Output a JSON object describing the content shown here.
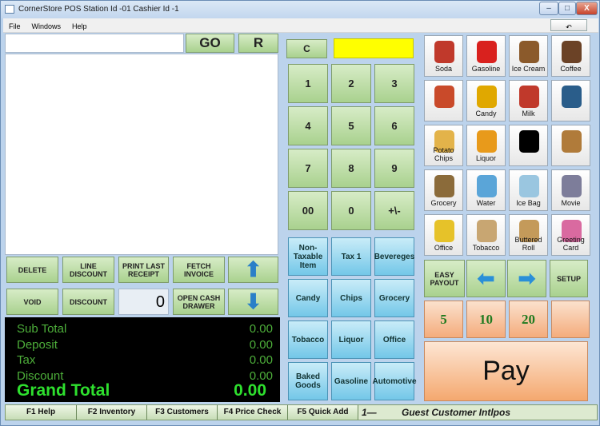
{
  "window": {
    "title": "CornerStore POS Station Id -01 Cashier Id -1",
    "min": "–",
    "max": "□",
    "close": "X"
  },
  "menu": [
    "File",
    "Windows",
    "Help"
  ],
  "undo_icon": "undo-arrow-icon",
  "entry": {
    "go": "GO",
    "r": "R",
    "value": ""
  },
  "keypad": {
    "clear": "C",
    "keys": [
      "1",
      "2",
      "3",
      "4",
      "5",
      "6",
      "7",
      "8",
      "9",
      "00",
      "0",
      "+\\-"
    ]
  },
  "actions": {
    "delete": "DELETE",
    "line_discount": "LINE DISCOUNT",
    "print_last": "PRINT LAST RECEIPT",
    "fetch": "FETCH INVOICE",
    "void": "VOID",
    "discount": "DISCOUNT",
    "qty": "0",
    "open_drawer": "OPEN CASH DRAWER"
  },
  "totals": {
    "subtotal_label": "Sub Total",
    "subtotal": "0.00",
    "deposit_label": "Deposit",
    "deposit": "0.00",
    "tax_label": "Tax",
    "tax": "0.00",
    "discount_label": "Discount",
    "discount": "0.00",
    "grand_label": "Grand Total",
    "grand": "0.00"
  },
  "categories": [
    "Non-Taxable Item",
    "Tax 1",
    "Bevereges",
    "Candy",
    "Chips",
    "Grocery",
    "Tobacco",
    "Liquor",
    "Office",
    "Baked Goods",
    "Gasoline",
    "Automotive"
  ],
  "products": [
    {
      "label": "Soda",
      "icon": "soda-icon",
      "color": "#c0392b"
    },
    {
      "label": "Gasoline",
      "icon": "gas-can-icon",
      "color": "#d9211e"
    },
    {
      "label": "Ice Cream",
      "icon": "ice-cream-icon",
      "color": "#8b5a2b"
    },
    {
      "label": "Coffee",
      "icon": "coffee-cup-icon",
      "color": "#6b4226"
    },
    {
      "label": "",
      "icon": "popcorn-icon",
      "color": "#c94a2a"
    },
    {
      "label": "Candy",
      "icon": "candy-icon",
      "color": "#e0a800"
    },
    {
      "label": "Milk",
      "icon": "milk-icon",
      "color": "#c0392b"
    },
    {
      "label": "",
      "icon": "magazine-icon",
      "color": "#2a5d8a"
    },
    {
      "label": "Potato Chips",
      "icon": "chips-icon",
      "color": "#e3b34a"
    },
    {
      "label": "Liquor",
      "icon": "liquor-glass-icon",
      "color": "#e89a1b"
    },
    {
      "label": "",
      "icon": "car-service-icon",
      "color": "#000000"
    },
    {
      "label": "",
      "icon": "cookies-icon",
      "color": "#b07b3a"
    },
    {
      "label": "Grocery",
      "icon": "grocery-bag-icon",
      "color": "#8b6b3a"
    },
    {
      "label": "Water",
      "icon": "water-bottle-icon",
      "color": "#5aa5d8"
    },
    {
      "label": "Ice Bag",
      "icon": "ice-bag-icon",
      "color": "#9ac6e0"
    },
    {
      "label": "Movie",
      "icon": "dvd-icon",
      "color": "#7d7d9a"
    },
    {
      "label": "Office",
      "icon": "office-supplies-icon",
      "color": "#e6c229"
    },
    {
      "label": "Tobacco",
      "icon": "tobacco-icon",
      "color": "#c8a672"
    },
    {
      "label": "Buttered Roll",
      "icon": "buttered-roll-icon",
      "color": "#c49a5a"
    },
    {
      "label": "Greeting Card",
      "icon": "greeting-card-icon",
      "color": "#d96aa0"
    }
  ],
  "nav": {
    "easy_payout": "EASY PAYOUT",
    "setup": "SETUP",
    "left_icon": "left-arrow-icon",
    "right_icon": "right-arrow-icon"
  },
  "cash": [
    "5",
    "10",
    "20",
    ""
  ],
  "pay": "Pay",
  "status": {
    "f1": "F1 Help",
    "f2": "F2 Inventory",
    "f3": "F3 Customers",
    "f4": "F4 Price Check",
    "f5": "F5 Quick Add",
    "number": "1—",
    "customer": "Guest Customer   Intlpos"
  },
  "colors": {
    "display_yellow": "#ffff00",
    "totals_green": "#2ee02e"
  }
}
